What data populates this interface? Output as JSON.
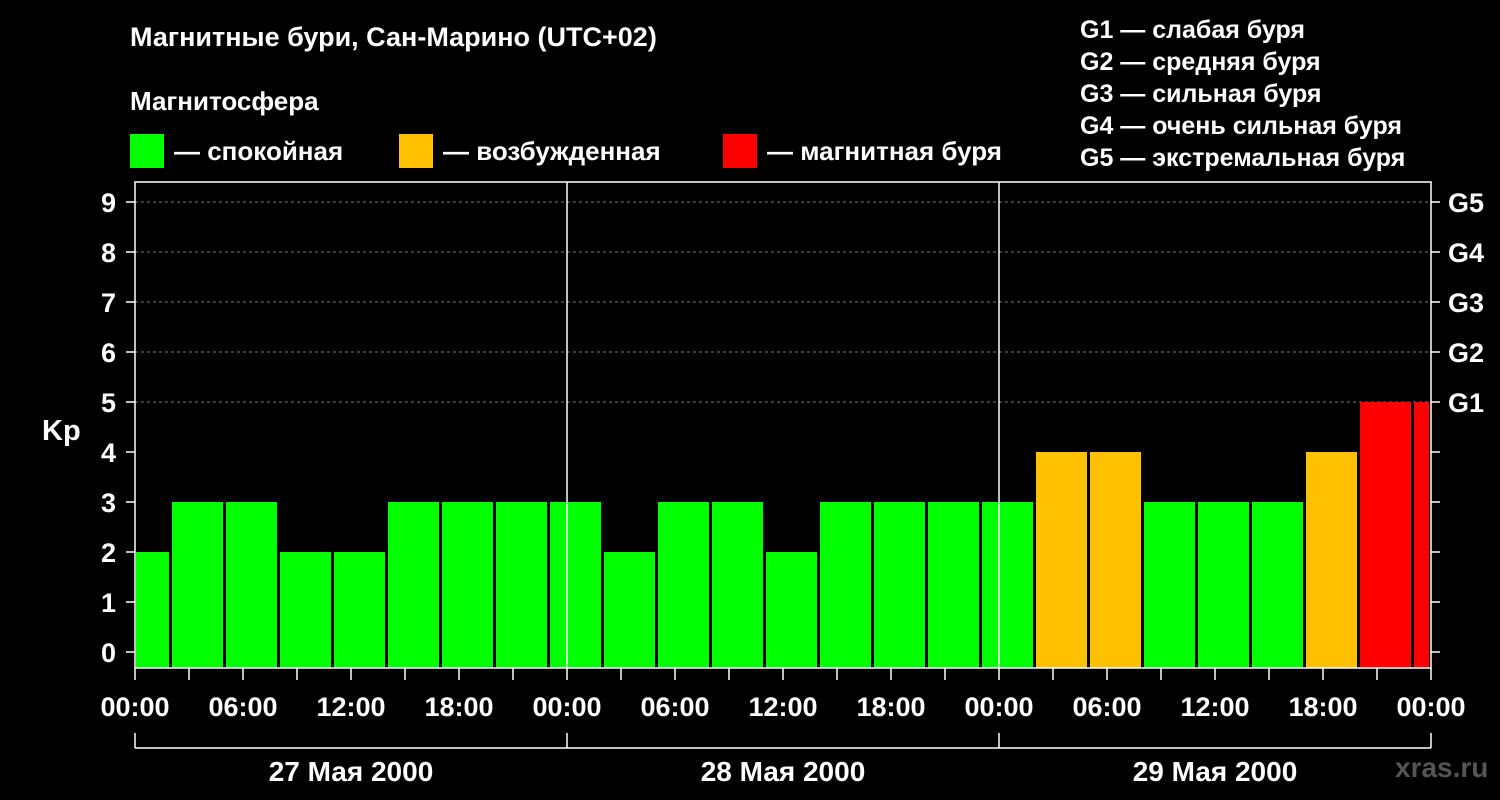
{
  "header": {
    "title": "Магнитные бури, Сан-Марино (UTC+02)",
    "subtitle": "Магнитосфера"
  },
  "legend": [
    {
      "label": "— спокойная",
      "color": "#00ff00"
    },
    {
      "label": "— возбужденная",
      "color": "#ffc000"
    },
    {
      "label": "— магнитная буря",
      "color": "#ff0000"
    }
  ],
  "g_scale": [
    "G1 — слабая буря",
    "G2 — средняя буря",
    "G3 — сильная буря",
    "G4 — очень сильная буря",
    "G5 — экстремальная буря"
  ],
  "watermark": "xras.ru",
  "chart_data": {
    "type": "bar",
    "ylabel": "Kp",
    "ylim": [
      0,
      9
    ],
    "yticks": [
      "0",
      "1",
      "2",
      "3",
      "4",
      "5",
      "6",
      "7",
      "8",
      "9"
    ],
    "right_axis_labels": [
      {
        "kp": 5,
        "label": "G1"
      },
      {
        "kp": 6,
        "label": "G2"
      },
      {
        "kp": 7,
        "label": "G3"
      },
      {
        "kp": 8,
        "label": "G4"
      },
      {
        "kp": 9,
        "label": "G5"
      }
    ],
    "xticks": [
      "00:00",
      "06:00",
      "12:00",
      "18:00",
      "00:00",
      "06:00",
      "12:00",
      "18:00",
      "00:00",
      "06:00",
      "12:00",
      "18:00",
      "00:00"
    ],
    "days": [
      "27 Мая 2000",
      "28 Мая 2000",
      "29 Мая 2000"
    ],
    "grid": true,
    "colors": {
      "quiet": "#00ff00",
      "active": "#ffc000",
      "storm": "#ff0000"
    },
    "bars": [
      {
        "start": 0,
        "end": 2,
        "kp": 2,
        "level": "quiet"
      },
      {
        "start": 2,
        "end": 5,
        "kp": 3,
        "level": "quiet"
      },
      {
        "start": 5,
        "end": 8,
        "kp": 3,
        "level": "quiet"
      },
      {
        "start": 8,
        "end": 11,
        "kp": 2,
        "level": "quiet"
      },
      {
        "start": 11,
        "end": 14,
        "kp": 2,
        "level": "quiet"
      },
      {
        "start": 14,
        "end": 17,
        "kp": 3,
        "level": "quiet"
      },
      {
        "start": 17,
        "end": 20,
        "kp": 3,
        "level": "quiet"
      },
      {
        "start": 20,
        "end": 23,
        "kp": 3,
        "level": "quiet"
      },
      {
        "start": 23,
        "end": 26,
        "kp": 3,
        "level": "quiet"
      },
      {
        "start": 26,
        "end": 29,
        "kp": 2,
        "level": "quiet"
      },
      {
        "start": 29,
        "end": 32,
        "kp": 3,
        "level": "quiet"
      },
      {
        "start": 32,
        "end": 35,
        "kp": 3,
        "level": "quiet"
      },
      {
        "start": 35,
        "end": 38,
        "kp": 2,
        "level": "quiet"
      },
      {
        "start": 38,
        "end": 41,
        "kp": 3,
        "level": "quiet"
      },
      {
        "start": 41,
        "end": 44,
        "kp": 3,
        "level": "quiet"
      },
      {
        "start": 44,
        "end": 47,
        "kp": 3,
        "level": "quiet"
      },
      {
        "start": 47,
        "end": 50,
        "kp": 3,
        "level": "quiet"
      },
      {
        "start": 50,
        "end": 53,
        "kp": 4,
        "level": "active"
      },
      {
        "start": 53,
        "end": 56,
        "kp": 4,
        "level": "active"
      },
      {
        "start": 56,
        "end": 59,
        "kp": 3,
        "level": "quiet"
      },
      {
        "start": 59,
        "end": 62,
        "kp": 3,
        "level": "quiet"
      },
      {
        "start": 62,
        "end": 65,
        "kp": 3,
        "level": "quiet"
      },
      {
        "start": 65,
        "end": 68,
        "kp": 4,
        "level": "active"
      },
      {
        "start": 68,
        "end": 71,
        "kp": 5,
        "level": "storm"
      },
      {
        "start": 71,
        "end": 72,
        "kp": 5,
        "level": "storm"
      }
    ]
  }
}
